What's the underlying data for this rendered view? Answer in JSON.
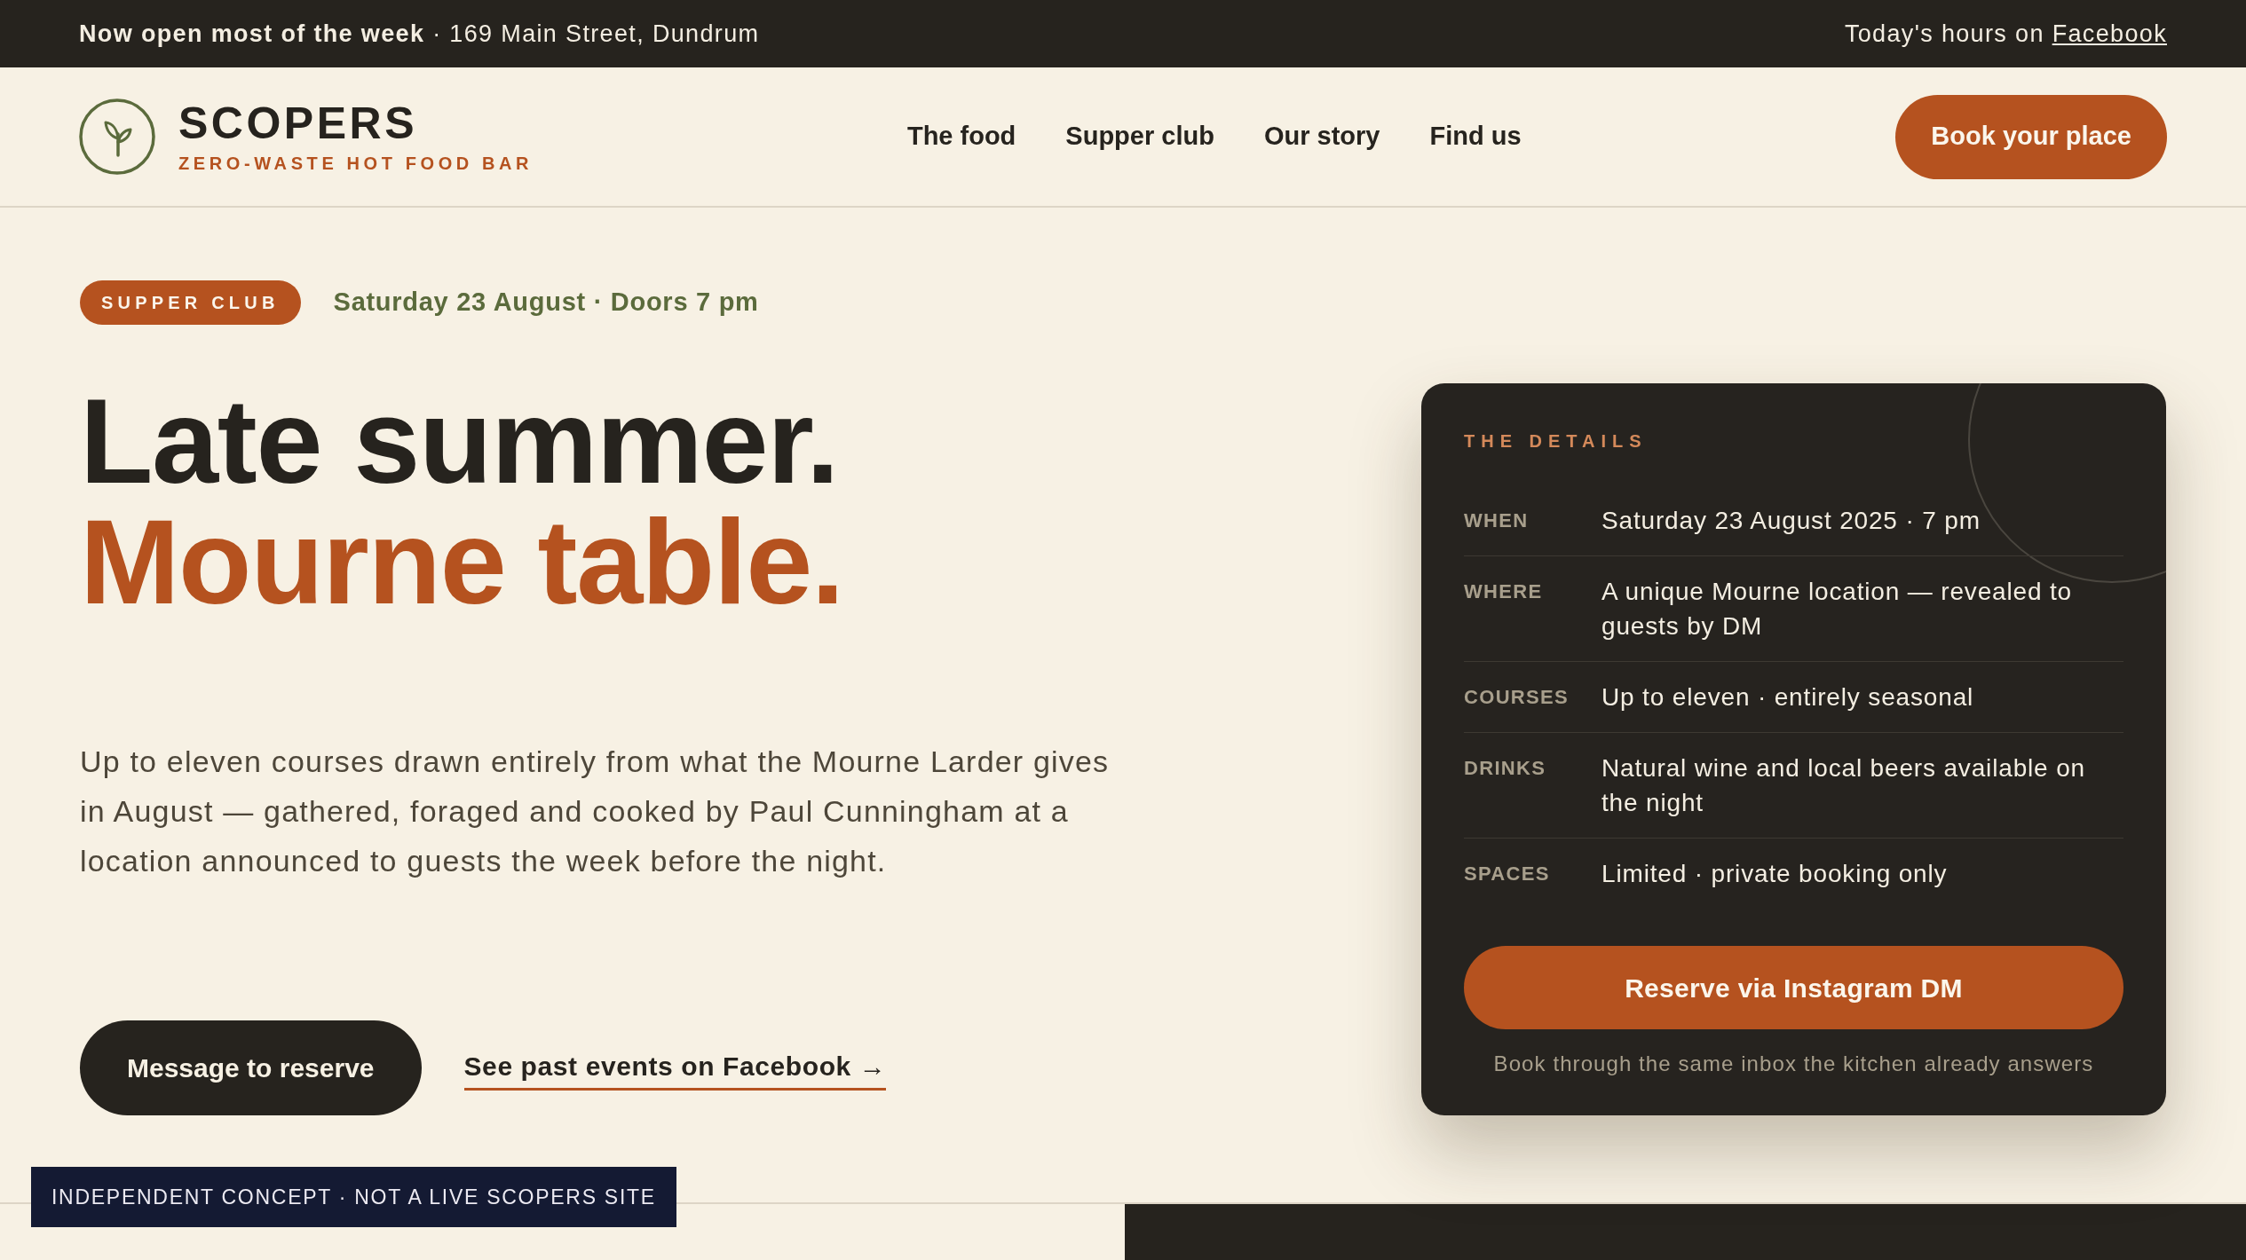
{
  "announcement_bar": {
    "text": "**Now open most of the week** · 169 Main Street, Dundrum",
    "hours_text": "Today's hours on",
    "hours_link": "Facebook"
  },
  "header": {
    "brand": {
      "name": "SCOPERS",
      "tagline": "ZERO-WASTE HOT FOOD BAR"
    },
    "nav": [
      {
        "label": "The food"
      },
      {
        "label": "Supper club"
      },
      {
        "label": "Our story"
      },
      {
        "label": "Find us"
      }
    ],
    "cta": "Book your place"
  },
  "hero": {
    "tag": "SUPPER CLUB",
    "date": "Saturday 23 August · Doors 7 pm",
    "headline": {
      "first_line": "Late summer.",
      "second_line": "Mourne table."
    },
    "intro": "Up to eleven courses drawn entirely from what the Mourne Larder gives in August — gathered, foraged and cooked by Paul Cunningham at a location announced to guests the week before the night.",
    "primary_button": "Message to reserve",
    "secondary_link": "See past events on Facebook →"
  },
  "details_card": {
    "title": "THE DETAILS",
    "rows": [
      {
        "label": "WHEN",
        "value": "Saturday 23 August 2025 · 7 pm"
      },
      {
        "label": "WHERE",
        "value": "A unique Mourne location — revealed to guests by DM"
      },
      {
        "label": "COURSES",
        "value": "Up to eleven · entirely seasonal"
      },
      {
        "label": "DRINKS",
        "value": "Natural wine and local beers available on the night"
      },
      {
        "label": "SPACES",
        "value": "Limited · private booking only"
      }
    ],
    "button": "Reserve via Instagram DM",
    "note": "Book through the same inbox the kitchen already answers"
  },
  "disclaimer": "INDEPENDENT CONCEPT · NOT A LIVE SCOPERS SITE"
}
